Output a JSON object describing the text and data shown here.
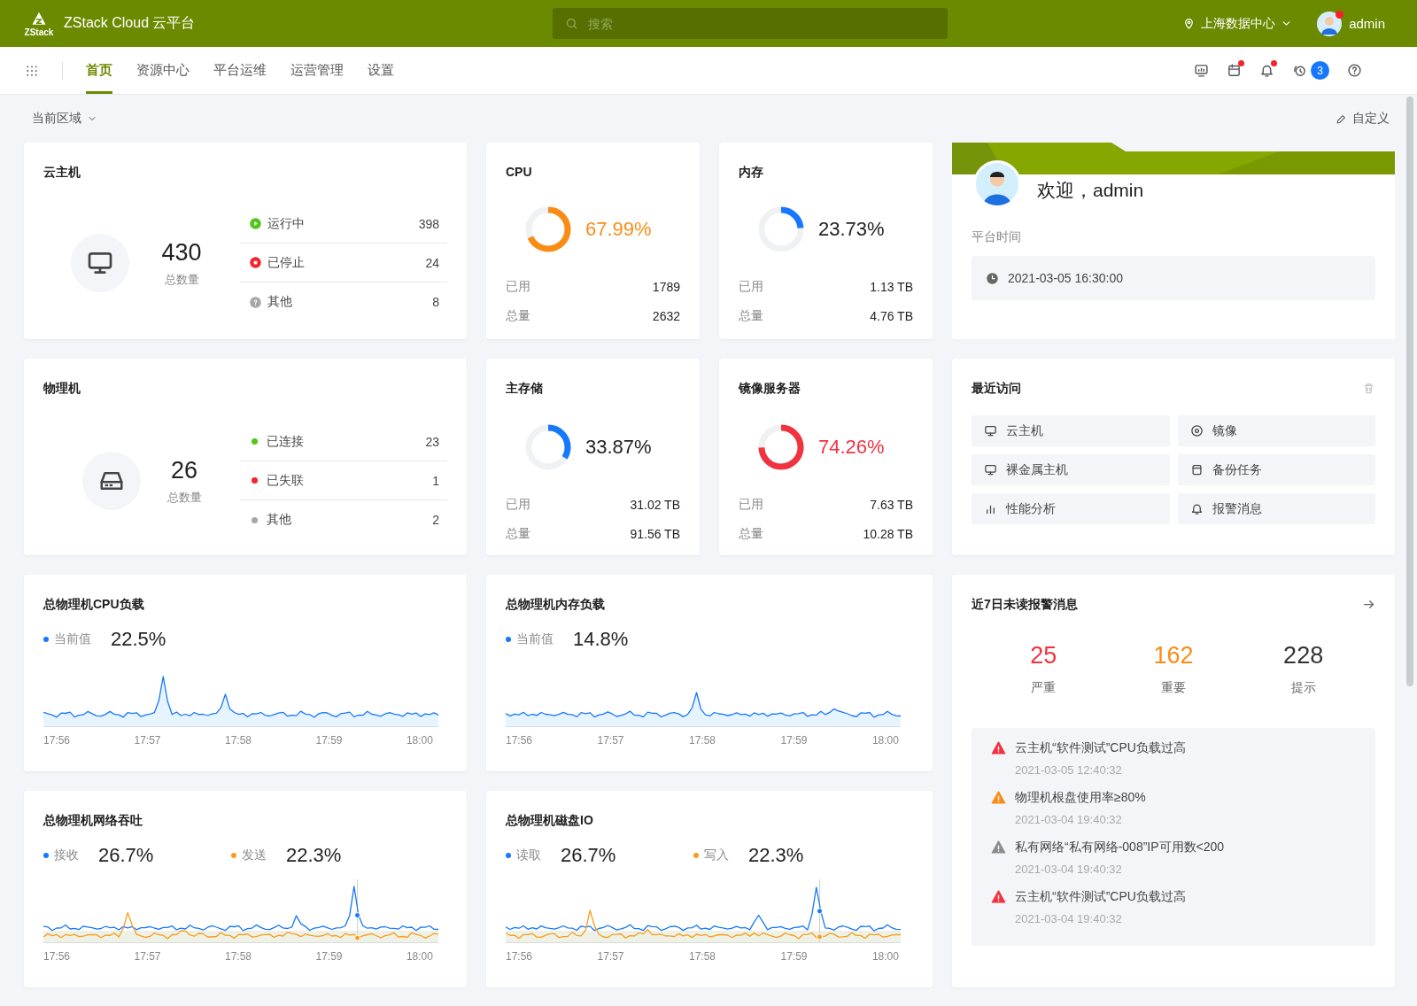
{
  "header": {
    "logo_text": "ZStack",
    "title": "ZStack Cloud 云平台",
    "search": {
      "placeholder": "搜索"
    },
    "region": "上海数据中心",
    "user": "admin",
    "user_alert": true
  },
  "nav": {
    "tabs": [
      {
        "label": "首页",
        "selected": true
      },
      {
        "label": "资源中心",
        "selected": false
      },
      {
        "label": "平台运维",
        "selected": false
      },
      {
        "label": "运营管理",
        "selected": false
      },
      {
        "label": "设置",
        "selected": false
      }
    ],
    "tools": [
      {
        "kind": "screen",
        "alert": false
      },
      {
        "kind": "calendar",
        "alert": true
      },
      {
        "kind": "bell",
        "alert": true
      },
      {
        "kind": "timer",
        "alert": false,
        "badge": "3"
      },
      {
        "kind": "help",
        "alert": false
      }
    ]
  },
  "toolbar": {
    "zone": "当前区域",
    "customize": "自定义"
  },
  "vm_card": {
    "title": "云主机",
    "total": "430",
    "total_label": "总数量",
    "statuses": [
      {
        "kind": "running",
        "label": "运行中",
        "value": "398",
        "color": "#52c41a"
      },
      {
        "kind": "stopped",
        "label": "已停止",
        "value": "24",
        "color": "#f5222d"
      },
      {
        "kind": "other",
        "label": "其他",
        "value": "8",
        "color": "#a6a6a6"
      }
    ]
  },
  "host_card": {
    "title": "物理机",
    "total": "26",
    "total_label": "总数量",
    "statuses": [
      {
        "kind": "dot",
        "label": "已连接",
        "value": "23",
        "color": "#52c41a"
      },
      {
        "kind": "dot",
        "label": "已失联",
        "value": "1",
        "color": "#f5222d"
      },
      {
        "kind": "dot",
        "label": "其他",
        "value": "2",
        "color": "#a6a6a6"
      }
    ]
  },
  "gauges": [
    {
      "title": "CPU",
      "value": "67.99%",
      "level": 0.6799,
      "kind": "warning",
      "rows": [
        {
          "label": "已用",
          "value": "1789"
        },
        {
          "label": "总量",
          "value": "2632"
        }
      ]
    },
    {
      "title": "内存",
      "value": "23.73%",
      "level": 0.2373,
      "kind": "normal",
      "rows": [
        {
          "label": "已用",
          "value": "1.13 TB"
        },
        {
          "label": "总量",
          "value": "4.76 TB"
        }
      ]
    },
    {
      "title": "主存储",
      "value": "33.87%",
      "level": 0.3387,
      "kind": "normal",
      "rows": [
        {
          "label": "已用",
          "value": "31.02 TB"
        },
        {
          "label": "总量",
          "value": "91.56 TB"
        }
      ]
    },
    {
      "title": "镜像服务器",
      "value": "74.26%",
      "level": 0.7426,
      "kind": "critical",
      "rows": [
        {
          "label": "已用",
          "value": "7.63 TB"
        },
        {
          "label": "总量",
          "value": "10.28 TB"
        }
      ]
    }
  ],
  "welcome": {
    "greeting": "欢迎，admin",
    "time_label": "平台时间",
    "time": "2021-03-05 16:30:00"
  },
  "recent": {
    "title": "最近访问",
    "items": [
      {
        "kind": "monitor",
        "label": "云主机"
      },
      {
        "kind": "disc",
        "label": "镜像"
      },
      {
        "kind": "monitor",
        "label": "裸金属主机"
      },
      {
        "kind": "backup",
        "label": "备份任务"
      },
      {
        "kind": "bars",
        "label": "性能分析"
      },
      {
        "kind": "bell",
        "label": "报警消息"
      }
    ]
  },
  "charts": [
    {
      "kind": "single",
      "title": "总物理机CPU负载",
      "series": [
        {
          "label": "当前值",
          "value": "22.5%",
          "color": "#1677ff"
        }
      ],
      "time_labels": [
        "17:56",
        "17:57",
        "17:58",
        "17:59",
        "18:00"
      ]
    },
    {
      "kind": "single",
      "title": "总物理机内存负载",
      "series": [
        {
          "label": "当前值",
          "value": "14.8%",
          "color": "#1677ff"
        }
      ],
      "time_labels": [
        "17:56",
        "17:57",
        "17:58",
        "17:59",
        "18:00"
      ]
    },
    {
      "kind": "dual",
      "title": "总物理机网络吞吐",
      "series": [
        {
          "label": "接收",
          "value": "26.7%",
          "color": "#1677ff"
        },
        {
          "label": "发送",
          "value": "22.3%",
          "color": "#fa9c1a"
        }
      ],
      "time_labels": [
        "17:56",
        "17:57",
        "17:58",
        "17:59",
        "18:00"
      ]
    },
    {
      "kind": "dual",
      "title": "总物理机磁盘IO",
      "series": [
        {
          "label": "读取",
          "value": "26.7%",
          "color": "#1677ff"
        },
        {
          "label": "写入",
          "value": "22.3%",
          "color": "#fa9c1a"
        }
      ],
      "time_labels": [
        "17:56",
        "17:57",
        "17:58",
        "17:59",
        "18:00"
      ]
    }
  ],
  "alerts": {
    "title": "近7日未读报警消息",
    "counts": [
      {
        "kind": "critical",
        "value": "25",
        "label": "严重"
      },
      {
        "kind": "warning",
        "value": "162",
        "label": "重要"
      },
      {
        "kind": "info",
        "value": "228",
        "label": "提示"
      }
    ],
    "messages": [
      {
        "kind": "critical",
        "text": "云主机“软件测试”CPU负载过高",
        "time": "2021-03-05 12:40:32"
      },
      {
        "kind": "warning",
        "text": "物理机根盘使用率≥80%",
        "time": "2021-03-04 19:40:32"
      },
      {
        "kind": "info",
        "text": "私有网络“私有网络-008”IP可用数<200",
        "time": "2021-03-04 19:40:32"
      },
      {
        "kind": "critical",
        "text": "云主机“软件测试”CPU负载过高",
        "time": "2021-03-04 19:40:32"
      }
    ]
  }
}
